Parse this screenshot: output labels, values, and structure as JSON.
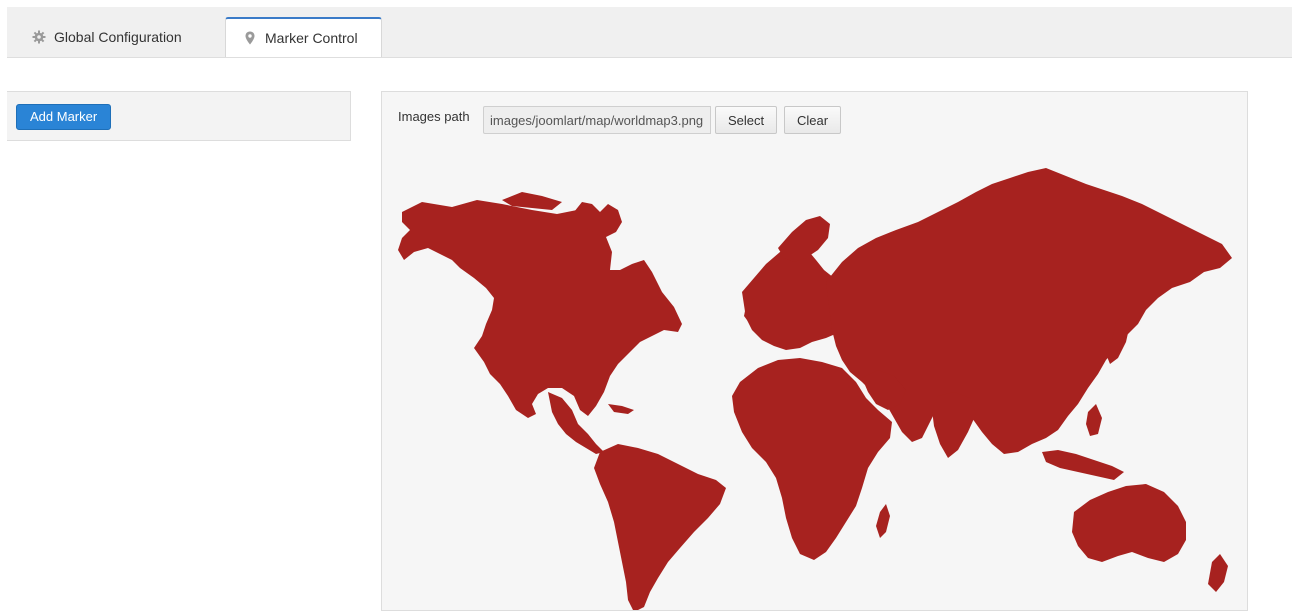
{
  "tabs": [
    {
      "label": "Global Configuration",
      "icon": "gear-icon",
      "active": false
    },
    {
      "label": "Marker Control",
      "icon": "map-pin-icon",
      "active": true
    }
  ],
  "sidebar": {
    "add_marker_label": "Add Marker"
  },
  "map_panel": {
    "images_path_label": "Images path",
    "images_path_value": "images/joomlart/map/worldmap3.png",
    "select_label": "Select",
    "clear_label": "Clear",
    "map_color": "#a7221f"
  },
  "colors": {
    "accent": "#2a84d6",
    "active_tab_border": "#3a7bc8"
  }
}
